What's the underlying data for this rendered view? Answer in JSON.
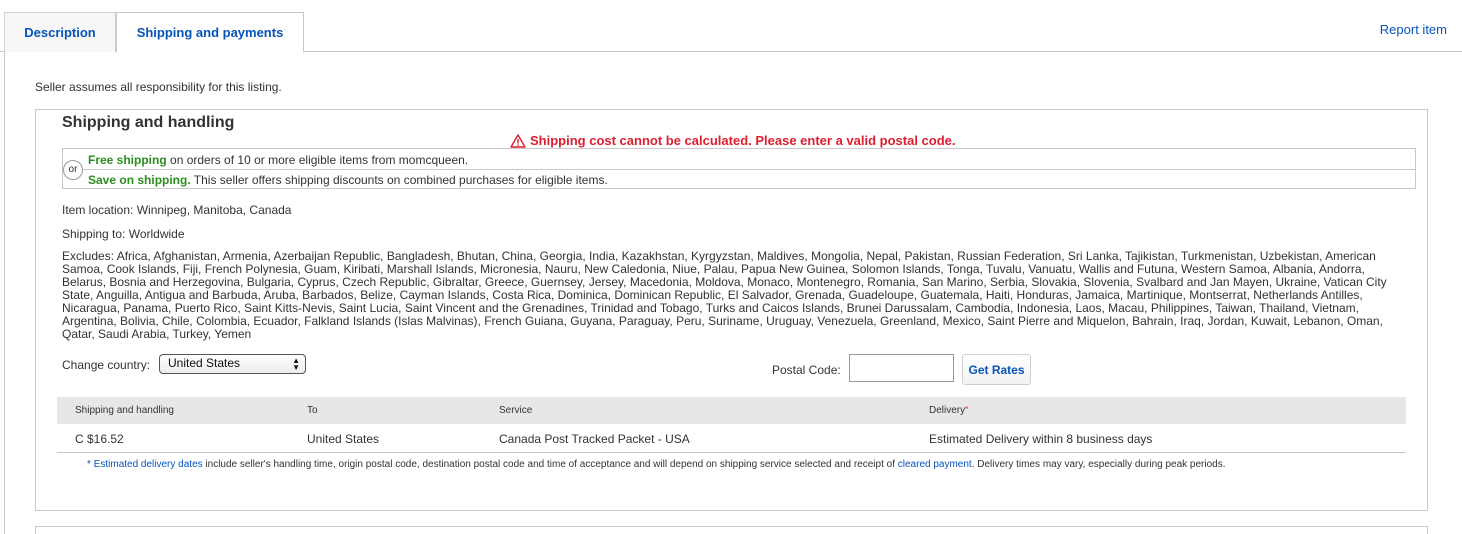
{
  "tabs": [
    {
      "label": "Description",
      "active": false
    },
    {
      "label": "Shipping and payments",
      "active": true
    }
  ],
  "report_link": "Report item",
  "seller_note": "Seller assumes all responsibility for this listing.",
  "shipping": {
    "title": "Shipping and handling",
    "error": "Shipping cost cannot be calculated. Please enter a valid postal code.",
    "promo": {
      "or": "or",
      "free_label": "Free shipping",
      "free_text": " on orders of 10 or more eligible items from momcqueen.",
      "save_label": "Save on shipping.",
      "save_text": " This seller offers shipping discounts on combined purchases for eligible items."
    },
    "item_location": "Item location: Winnipeg, Manitoba, Canada",
    "shipping_to": "Shipping to: Worldwide",
    "excludes": "Excludes: Africa, Afghanistan, Armenia, Azerbaijan Republic, Bangladesh, Bhutan, China, Georgia, India, Kazakhstan, Kyrgyzstan, Maldives, Mongolia, Nepal, Pakistan, Russian Federation, Sri Lanka, Tajikistan, Turkmenistan, Uzbekistan, American Samoa, Cook Islands, Fiji, French Polynesia, Guam, Kiribati, Marshall Islands, Micronesia, Nauru, New Caledonia, Niue, Palau, Papua New Guinea, Solomon Islands, Tonga, Tuvalu, Vanuatu, Wallis and Futuna, Western Samoa, Albania, Andorra, Belarus, Bosnia and Herzegovina, Bulgaria, Cyprus, Czech Republic, Gibraltar, Greece, Guernsey, Jersey, Macedonia, Moldova, Monaco, Montenegro, Romania, San Marino, Serbia, Slovakia, Slovenia, Svalbard and Jan Mayen, Ukraine, Vatican City State, Anguilla, Antigua and Barbuda, Aruba, Barbados, Belize, Cayman Islands, Costa Rica, Dominica, Dominican Republic, El Salvador, Grenada, Guadeloupe, Guatemala, Haiti, Honduras, Jamaica, Martinique, Montserrat, Netherlands Antilles, Nicaragua, Panama, Puerto Rico, Saint Kitts-Nevis, Saint Lucia, Saint Vincent and the Grenadines, Trinidad and Tobago, Turks and Caicos Islands, Brunei Darussalam, Cambodia, Indonesia, Laos, Macau, Philippines, Taiwan, Thailand, Vietnam, Argentina, Bolivia, Chile, Colombia, Ecuador, Falkland Islands (Islas Malvinas), French Guiana, Guyana, Paraguay, Peru, Suriname, Uruguay, Venezuela, Greenland, Mexico, Saint Pierre and Miquelon, Bahrain, Iraq, Jordan, Kuwait, Lebanon, Oman, Qatar, Saudi Arabia, Turkey, Yemen",
    "change_country_label": "Change country:",
    "country_value": "United States",
    "postal_label": "Postal Code:",
    "postal_value": "",
    "get_rates_label": "Get Rates",
    "table": {
      "headers": [
        "Shipping and handling",
        "To",
        "Service",
        "Delivery"
      ],
      "delivery_asterisk": "*",
      "rows": [
        [
          "C $16.52",
          "United States",
          "Canada Post Tracked Packet - USA",
          "Estimated Delivery within 8 business days"
        ]
      ]
    },
    "footnote": {
      "star": "*",
      "link1": "Estimated delivery dates",
      "text1": " include seller's handling time, origin postal code, destination postal code and time of acceptance and will depend on shipping service selected and receipt of ",
      "link2": "cleared payment",
      "text2": ". Delivery times may vary, especially during peak periods."
    }
  },
  "colors": {
    "link": "#0654ba",
    "error": "#dd1e31",
    "promo_green": "#2a8f1f",
    "table_header_bg": "#e7e7e7"
  }
}
